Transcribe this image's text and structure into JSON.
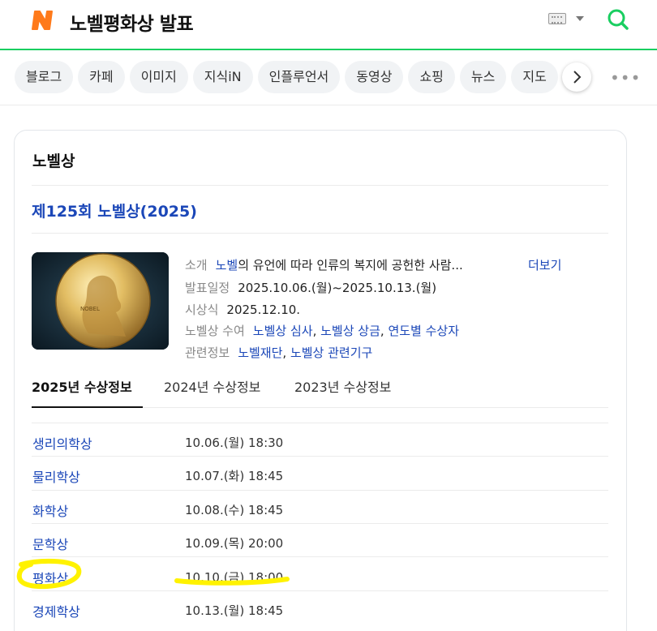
{
  "search": {
    "query": "노벨평화상 발표"
  },
  "tabs": [
    {
      "label": "블로그"
    },
    {
      "label": "카페"
    },
    {
      "label": "이미지"
    },
    {
      "label": "지식iN"
    },
    {
      "label": "인플루언서"
    },
    {
      "label": "동영상"
    },
    {
      "label": "쇼핑"
    },
    {
      "label": "뉴스"
    },
    {
      "label": "지도"
    }
  ],
  "card": {
    "title": "노벨상",
    "subtitle": "제125회 노벨상(2025)",
    "image_alt_text": "NOBEL",
    "info": {
      "intro_label": "소개",
      "intro_link": "노벨",
      "intro_text": "의 유언에 따라 인류의 복지에 공헌한 사람...",
      "more": "더보기",
      "announce_label": "발표일정",
      "announce_value": "2025.10.06.(월)~2025.10.13.(월)",
      "ceremony_label": "시상식",
      "ceremony_value": "2025.12.10.",
      "award_label": "노벨상 수여",
      "award_links": [
        "노벨상 심사",
        "노벨상 상금",
        "연도별 수상자"
      ],
      "related_label": "관련정보",
      "related_links": [
        "노벨재단",
        "노벨상 관련기구"
      ]
    },
    "year_tabs": [
      "2025년 수상정보",
      "2024년 수상정보",
      "2023년 수상정보"
    ],
    "active_year_tab": "2025년 수상정보",
    "prizes": [
      {
        "name": "생리의학상",
        "date": "10.06.(월) 18:30"
      },
      {
        "name": "물리학상",
        "date": "10.07.(화) 18:45"
      },
      {
        "name": "화학상",
        "date": "10.08.(수) 18:45"
      },
      {
        "name": "문학상",
        "date": "10.09.(목) 20:00"
      },
      {
        "name": "평화상",
        "date": "10.10.(금) 18:00"
      },
      {
        "name": "경제학상",
        "date": "10.13.(월) 18:45"
      }
    ]
  },
  "colors": {
    "brand_green": "#19ce60",
    "logo_orange": "#ff7a1a",
    "link_blue": "#1b47b8",
    "highlight_yellow": "#fff200"
  }
}
